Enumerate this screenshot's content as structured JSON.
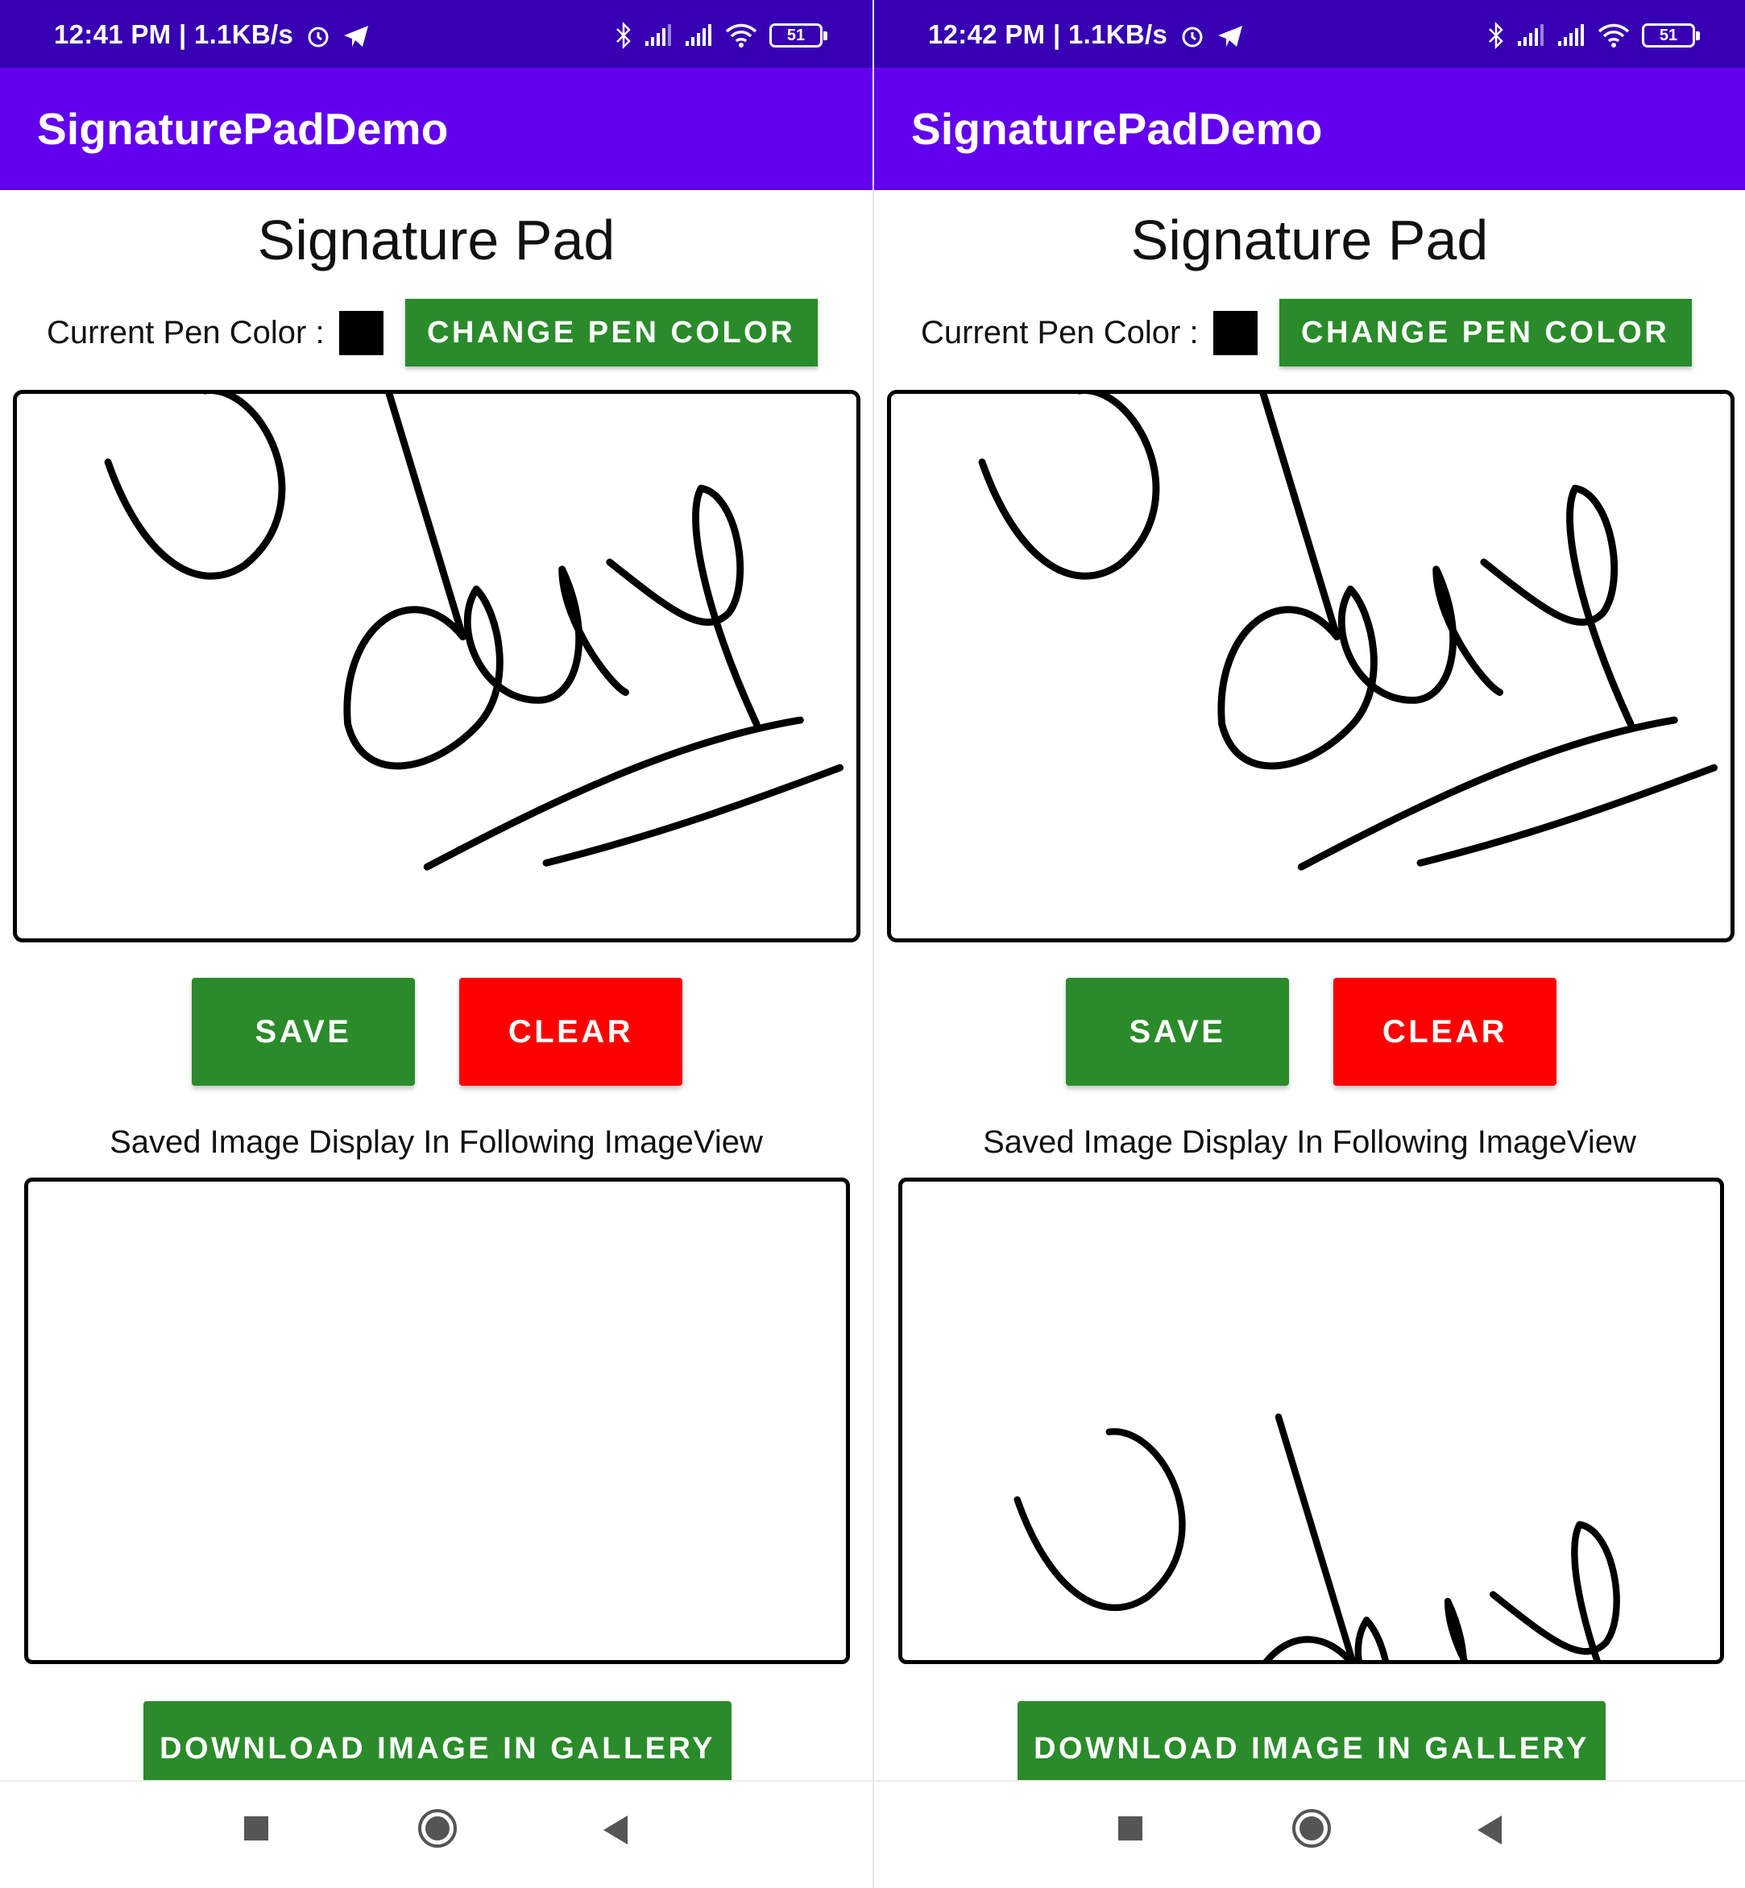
{
  "screens": [
    {
      "status_bar": {
        "time": "12:41 PM | 1.1KB/s",
        "battery": "51"
      },
      "app_bar": {
        "title": "SignaturePadDemo"
      },
      "page_title": "Signature Pad",
      "pen": {
        "label": "Current Pen Color :",
        "color": "#000000",
        "change_button": "CHANGE PEN COLOR"
      },
      "signature_pad": {
        "has_signature": true
      },
      "buttons": {
        "save": "SAVE",
        "clear": "CLEAR"
      },
      "saved_label": "Saved Image Display In Following ImageView",
      "image_view": {
        "has_image": false
      },
      "download_button": "DOWNLOAD IMAGE IN GALLERY"
    },
    {
      "status_bar": {
        "time": "12:42 PM | 1.1KB/s",
        "battery": "51"
      },
      "app_bar": {
        "title": "SignaturePadDemo"
      },
      "page_title": "Signature Pad",
      "pen": {
        "label": "Current Pen Color :",
        "color": "#000000",
        "change_button": "CHANGE PEN COLOR"
      },
      "signature_pad": {
        "has_signature": true
      },
      "buttons": {
        "save": "SAVE",
        "clear": "CLEAR"
      },
      "saved_label": "Saved Image Display In Following ImageView",
      "image_view": {
        "has_image": true
      },
      "download_button": "DOWNLOAD IMAGE IN GALLERY"
    }
  ],
  "icons": {
    "status": [
      "alarm-icon",
      "telegram-icon",
      "bluetooth-icon",
      "signal-icon",
      "signal-icon",
      "wifi-icon",
      "battery-icon"
    ],
    "nav": [
      "recents-icon",
      "home-icon",
      "back-icon"
    ]
  },
  "colors": {
    "status_bar": "#3700b3",
    "app_bar": "#6200ee",
    "green_button": "#2a8b2a",
    "clear_button": "#ff0000"
  }
}
